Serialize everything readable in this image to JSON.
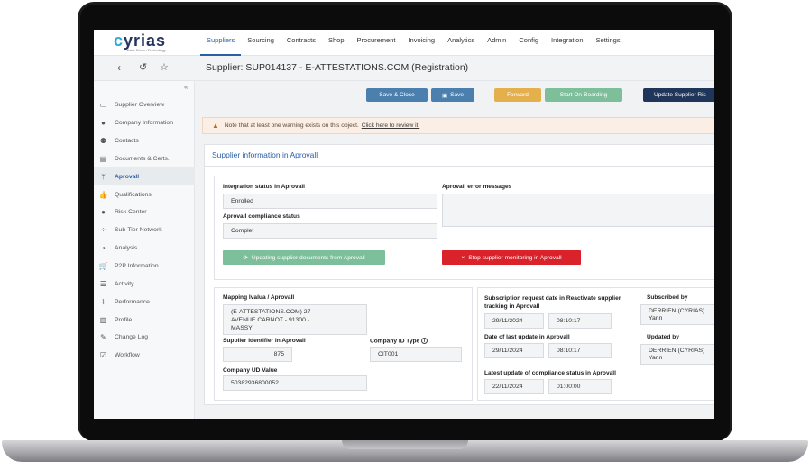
{
  "logo": {
    "name": "cyrias",
    "tagline": "Value Driven Technology"
  },
  "nav": {
    "items": [
      "Suppliers",
      "Sourcing",
      "Contracts",
      "Shop",
      "Procurement",
      "Invoicing",
      "Analytics",
      "Admin",
      "Config",
      "Integration",
      "Settings"
    ],
    "active": "Suppliers"
  },
  "header": {
    "title": "Supplier: SUP014137 - E-ATTESTATIONS.COM (Registration)",
    "icons": [
      "back-icon",
      "history-icon",
      "star-icon"
    ]
  },
  "sidebar": {
    "collapse_icon": "«",
    "items": [
      {
        "label": "Supplier Overview",
        "icon": "monitor-icon"
      },
      {
        "label": "Company Information",
        "icon": "user-icon"
      },
      {
        "label": "Contacts",
        "icon": "users-icon"
      },
      {
        "label": "Documents & Certs.",
        "icon": "document-icon"
      },
      {
        "label": "Aprovall",
        "icon": "branch-icon",
        "active": true
      },
      {
        "label": "Qualifications",
        "icon": "thumbs-up-icon"
      },
      {
        "label": "Risk Center",
        "icon": "alert-icon"
      },
      {
        "label": "Sub-Tier Network",
        "icon": "network-icon"
      },
      {
        "label": "Analysis",
        "icon": "chart-icon"
      },
      {
        "label": "P2P Information",
        "icon": "cart-icon"
      },
      {
        "label": "Activity",
        "icon": "list-icon"
      },
      {
        "label": "Performance",
        "icon": "performance-icon"
      },
      {
        "label": "Profile",
        "icon": "bar-chart-icon"
      },
      {
        "label": "Change Log",
        "icon": "edit-icon"
      },
      {
        "label": "Workflow",
        "icon": "check-square-icon"
      }
    ]
  },
  "toolbar": {
    "save_close": "Save & Close",
    "save": "Save",
    "forward": "Forward",
    "onboarding": "Start On-Boarding",
    "update": "Update Supplier Ris"
  },
  "warning": {
    "text": "Note that at least one warning exists on this object.",
    "link": "Click here to review it."
  },
  "card": {
    "title": "Supplier information in Aprovall",
    "integration_status_label": "Integration status in Aprovall",
    "integration_status_value": "Enrolled",
    "compliance_status_label": "Aprovall compliance status",
    "compliance_status_value": "Complet",
    "error_messages_label": "Aprovall error messages",
    "btn_update_docs": "Updating supplier documents from Aprovall",
    "btn_stop_monitoring": "Stop supplier monitoring in Aprovall",
    "mapping_label": "Mapping Ivalua / Aprovall",
    "mapping_value_1": "(E-ATTESTATIONS.COM) 27",
    "mapping_value_2": "AVENUE CARNOT - 91300 -",
    "mapping_value_3": "MASSY",
    "supplier_id_label": "Supplier identifier in Aprovall",
    "supplier_id_value": "875",
    "company_id_type_label": "Company ID Type",
    "company_id_type_value": "CIT001",
    "company_ud_label": "Company UD Value",
    "company_ud_value": "50382936800052",
    "subscription_label_1": "Subscription request date in Reactivate supplier",
    "subscription_label_2": "tracking in Aprovall",
    "subscription_date": "29/11/2024",
    "subscription_time": "08:10:17",
    "last_update_label": "Date of last update in Aprovall",
    "last_update_date": "29/11/2024",
    "last_update_time": "08:10:17",
    "compliance_update_label": "Latest update of compliance status in Aprovall",
    "compliance_update_date": "22/11/2024",
    "compliance_update_time": "01:00:00",
    "subscribed_by_label": "Subscribed by",
    "subscribed_by_1": "DERRIEN (CYRIAS)",
    "subscribed_by_2": "Yann",
    "updated_by_label": "Updated by",
    "updated_by_1": "DERRIEN (CYRIAS)",
    "updated_by_2": "Yann"
  },
  "colors": {
    "nav_active": "#2b5fa6",
    "save_btn": "#4a7fae",
    "forward_btn": "#e3b04b",
    "onboarding_btn": "#7cbf9a",
    "update_btn": "#1f3559",
    "stop_btn": "#d9222a"
  }
}
